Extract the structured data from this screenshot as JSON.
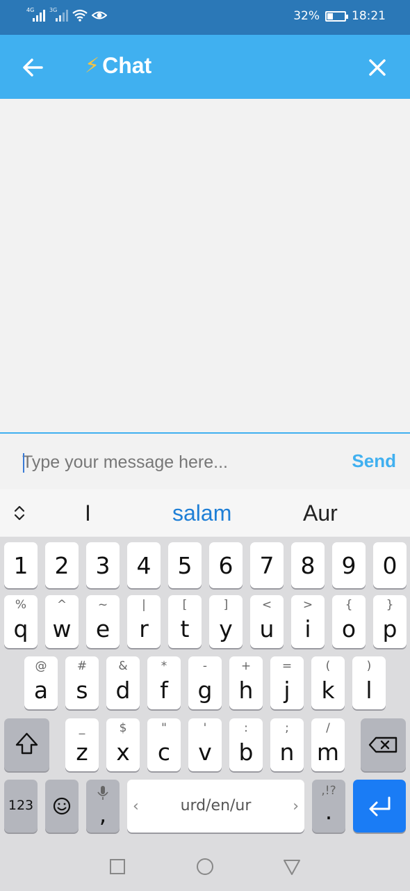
{
  "status_bar": {
    "network_1": "4G",
    "network_2": "3G",
    "battery_text": "32%",
    "battery_level": 0.32,
    "time": "18:21"
  },
  "app_bar": {
    "title_icon": "⚡",
    "title": "Chat"
  },
  "input": {
    "placeholder": "Type your message here...",
    "value": "",
    "send_label": "Send"
  },
  "suggestions": [
    "I",
    "salam",
    "Aur"
  ],
  "keyboard": {
    "digits": [
      "1",
      "2",
      "3",
      "4",
      "5",
      "6",
      "7",
      "8",
      "9",
      "0"
    ],
    "row1": [
      {
        "k": "q",
        "s": "%"
      },
      {
        "k": "w",
        "s": "^"
      },
      {
        "k": "e",
        "s": "~"
      },
      {
        "k": "r",
        "s": "|"
      },
      {
        "k": "t",
        "s": "["
      },
      {
        "k": "y",
        "s": "]"
      },
      {
        "k": "u",
        "s": "<"
      },
      {
        "k": "i",
        "s": ">"
      },
      {
        "k": "o",
        "s": "{"
      },
      {
        "k": "p",
        "s": "}"
      }
    ],
    "row2": [
      {
        "k": "a",
        "s": "@"
      },
      {
        "k": "s",
        "s": "#"
      },
      {
        "k": "d",
        "s": "&"
      },
      {
        "k": "f",
        "s": "*"
      },
      {
        "k": "g",
        "s": "-"
      },
      {
        "k": "h",
        "s": "+"
      },
      {
        "k": "j",
        "s": "="
      },
      {
        "k": "k",
        "s": "("
      },
      {
        "k": "l",
        "s": ")"
      }
    ],
    "row3": [
      {
        "k": "z",
        "s": "_"
      },
      {
        "k": "x",
        "s": "$"
      },
      {
        "k": "c",
        "s": "\""
      },
      {
        "k": "v",
        "s": "'"
      },
      {
        "k": "b",
        "s": ":"
      },
      {
        "k": "n",
        "s": ";"
      },
      {
        "k": "m",
        "s": "/"
      }
    ],
    "numbers_key": "123",
    "comma_key": ",",
    "space_label": "urd/en/ur",
    "period_key": ".",
    "period_sub": ",!?"
  },
  "colors": {
    "status_bar": "#2b78b7",
    "app_bar": "#40b0f0",
    "send": "#40b0f0",
    "suggestion_highlight": "#1f7fd6",
    "enter_key": "#1a7cf5"
  }
}
